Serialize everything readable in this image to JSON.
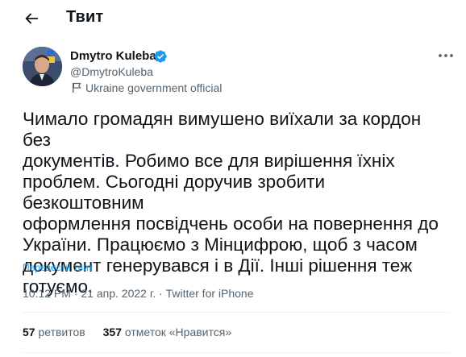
{
  "header": {
    "title": "Твит",
    "back_icon": "arrow-left-icon"
  },
  "author": {
    "name": "Dmytro Kuleba",
    "handle": "@DmytroKuleba",
    "verified_icon": "verified-badge-icon",
    "label_icon": "flag-icon",
    "label": "Ukraine government official",
    "more_icon": "more-horizontal-icon"
  },
  "tweet": {
    "text": "Чимало громадян вимушено виїхали за кордон без\nдокументів. Робимо все для вирішення їхніх\nпроблем. Сьогодні доручив зробити безкоштовним\nоформлення посвідчень особи на повернення до\nУкраїни. Працюємо з Мінцифрою, щоб з часом\nдокумент генерувався і в Дії. Інші рішення теж\nготуємо.",
    "translate": "Перевести твит"
  },
  "meta": {
    "time": "10:12 PM",
    "sep1": " · ",
    "date": "21 апр. 2022 г.",
    "sep2": " · ",
    "source": "Twitter for iPhone"
  },
  "stats": {
    "retweets_count": "57",
    "retweets_label": "ретвитов",
    "likes_count": "357",
    "likes_label": "отметок «Нравится»"
  },
  "colors": {
    "accent": "#1d9bf0",
    "text": "#0f1419",
    "secondary": "#536471",
    "divider": "#eff3f4"
  }
}
